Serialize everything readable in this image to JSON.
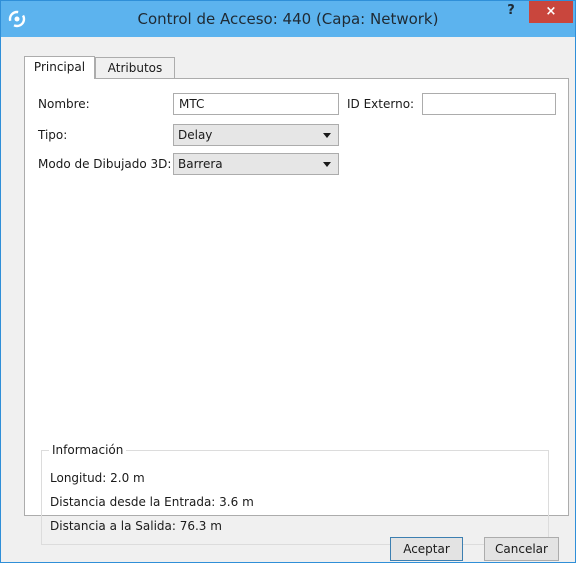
{
  "window": {
    "title": "Control de Acceso: 440 (Capa: Network)",
    "help_label": "?",
    "close_label": "×",
    "accent_color": "#5cb3ee",
    "close_color": "#c9463d"
  },
  "tabs": [
    {
      "label": "Principal",
      "active": true
    },
    {
      "label": "Atributos",
      "active": false
    }
  ],
  "form": {
    "nombre_label": "Nombre:",
    "nombre_value": "MTC",
    "id_externo_label": "ID Externo:",
    "id_externo_value": "",
    "tipo_label": "Tipo:",
    "tipo_value": "Delay",
    "modo_label": "Modo de Dibujado 3D:",
    "modo_value": "Barrera"
  },
  "info": {
    "title": "Información",
    "longitud": "Longitud: 2.0 m",
    "distancia_entrada": "Distancia desde la Entrada: 3.6 m",
    "distancia_salida": "Distancia a la Salida: 76.3 m"
  },
  "buttons": {
    "ok_label": "Aceptar",
    "cancel_label": "Cancelar"
  }
}
